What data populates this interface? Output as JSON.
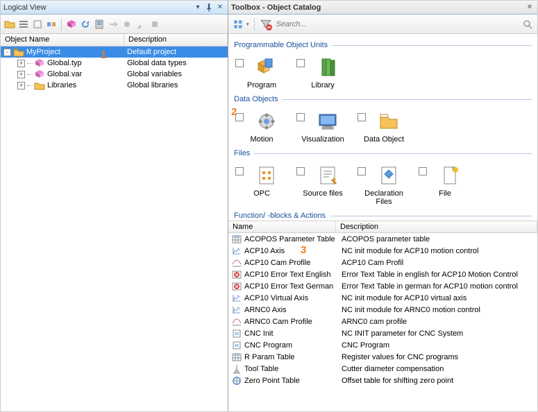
{
  "left": {
    "title": "Logical View",
    "columns": {
      "name": "Object Name",
      "desc": "Description"
    },
    "tree": [
      {
        "id": "root",
        "depth": 0,
        "expander": "-",
        "icon": "project",
        "label": "MyProject",
        "desc": "Default project",
        "selected": true
      },
      {
        "id": "typ",
        "depth": 1,
        "expander": "+",
        "icon": "typ",
        "label": "Global.typ",
        "desc": "Global data types"
      },
      {
        "id": "var",
        "depth": 1,
        "expander": "+",
        "icon": "var",
        "label": "Global.var",
        "desc": "Global variables"
      },
      {
        "id": "lib",
        "depth": 1,
        "expander": "+",
        "icon": "folder",
        "label": "Libraries",
        "desc": "Global libraries"
      }
    ],
    "callout_1": "1"
  },
  "right": {
    "title": "Toolbox - Object Catalog",
    "search_placeholder": "Search...",
    "groups": [
      {
        "title": "Programmable Object Units",
        "items": [
          {
            "icon": "program",
            "label": "Program"
          },
          {
            "icon": "library",
            "label": "Library"
          }
        ]
      },
      {
        "title": "Data Objects",
        "callout": "2",
        "items": [
          {
            "icon": "motion",
            "label": "Motion"
          },
          {
            "icon": "visualization",
            "label": "Visualization"
          },
          {
            "icon": "dataobject",
            "label": "Data Object"
          }
        ]
      },
      {
        "title": "Files",
        "items": [
          {
            "icon": "opc",
            "label": "OPC"
          },
          {
            "icon": "source",
            "label": "Source files"
          },
          {
            "icon": "decl",
            "label": "Declaration Files"
          },
          {
            "icon": "file",
            "label": "File"
          }
        ]
      },
      {
        "title": "Function/ -blocks & Actions",
        "items": []
      }
    ],
    "list_columns": {
      "name": "Name",
      "desc": "Description"
    },
    "callout_3": "3",
    "list": [
      {
        "icon": "table",
        "name": "ACOPOS Parameter Table",
        "desc": "ACOPOS parameter table"
      },
      {
        "icon": "axis",
        "name": "ACP10 Axis",
        "desc": "NC init module for ACP10 motion control"
      },
      {
        "icon": "cam",
        "name": "ACP10 Cam Profile",
        "desc": "ACP10 Cam Profil"
      },
      {
        "icon": "err",
        "name": "ACP10 Error Text English",
        "desc": "Error Text Table in english for ACP10 Motion Control"
      },
      {
        "icon": "err",
        "name": "ACP10 Error Text German",
        "desc": "Error Text Table in german for ACP10 motion control"
      },
      {
        "icon": "axis",
        "name": "ACP10 Virtual Axis",
        "desc": "NC init module for ACP10 virtual axis"
      },
      {
        "icon": "axis",
        "name": "ARNC0 Axis",
        "desc": "NC init module for ARNC0 motion control"
      },
      {
        "icon": "cam",
        "name": "ARNC0 Cam Profile",
        "desc": "ARNC0 cam profile"
      },
      {
        "icon": "cnc",
        "name": "CNC Init",
        "desc": "NC INIT parameter for CNC System"
      },
      {
        "icon": "cnc",
        "name": "CNC Program",
        "desc": "CNC Program"
      },
      {
        "icon": "table",
        "name": "R Param Table",
        "desc": "Register values for CNC programs"
      },
      {
        "icon": "tool",
        "name": "Tool Table",
        "desc": "Cutter diameter compensation"
      },
      {
        "icon": "zero",
        "name": "Zero Point Table",
        "desc": "Offset table for shifting zero point"
      }
    ]
  }
}
